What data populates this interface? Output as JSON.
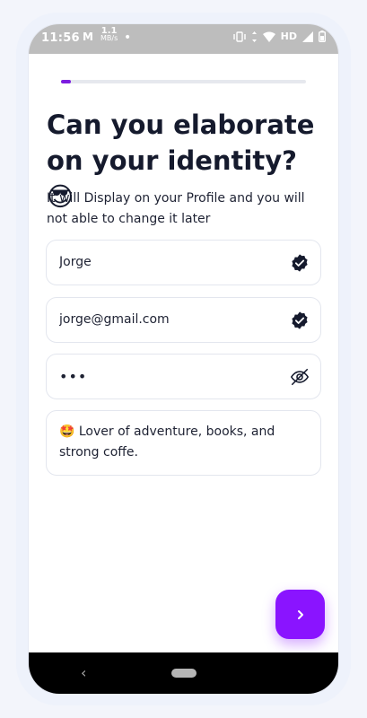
{
  "status_bar": {
    "time": "11:56",
    "carrier_icon": "M",
    "speed_value": "1.1",
    "speed_unit": "MB/s",
    "dot": "•",
    "network_label": "HD"
  },
  "progress": {
    "value": 0.04
  },
  "content": {
    "title": "Can you elaborate on your identity? 😎",
    "subtitle": "It will Display on your Profile and you will not able to change it later"
  },
  "form": {
    "name_value": "Jorge",
    "email_value": "jorge@gmail.com",
    "password_mask": "•••",
    "bio_value": "🤩 Lover of adventure, books, and strong coffe."
  },
  "icons": {
    "name_status": "verified-badge",
    "email_status": "verified-badge",
    "password_toggle": "eye-off",
    "next": "chevron-right"
  },
  "colors": {
    "accent": "#8a14ff",
    "title_text": "#151a2d",
    "status_bar": "#bdbdbd"
  }
}
